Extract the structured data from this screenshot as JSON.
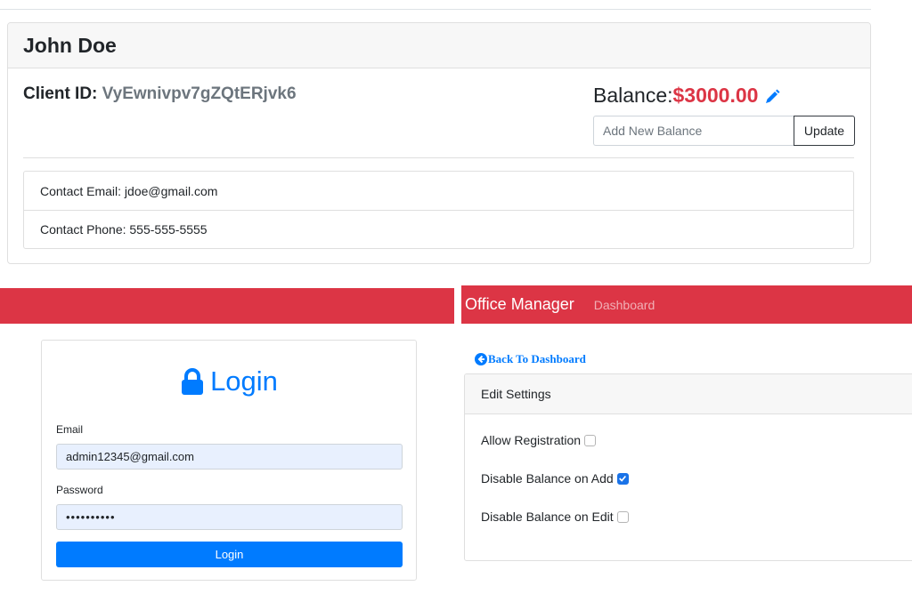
{
  "client": {
    "name": "John Doe",
    "id_label": "Client ID:",
    "id_value": "VyEwnivpv7gZQtERjvk6",
    "balance_label": "Balance:",
    "balance_value": "$3000.00",
    "balance_input_placeholder": "Add New Balance",
    "update_label": "Update",
    "contacts": [
      "Contact Email: jdoe@gmail.com",
      "Contact Phone: 555-555-5555"
    ]
  },
  "navbar": {
    "brand": "Office Manager",
    "link": "Dashboard"
  },
  "login": {
    "title": "Login",
    "email_label": "Email",
    "email_value": "admin12345@gmail.com",
    "password_label": "Password",
    "password_value": "••••••••••",
    "button_label": "Login"
  },
  "settings": {
    "back_label": "Back To Dashboard",
    "header": "Edit Settings",
    "items": [
      {
        "label": "Allow Registration",
        "checked": false
      },
      {
        "label": "Disable Balance on Add",
        "checked": true
      },
      {
        "label": "Disable Balance on Edit",
        "checked": false
      }
    ]
  },
  "colors": {
    "danger": "#dc3545",
    "primary": "#007bff",
    "navbar": "#dc3545"
  },
  "icons": {
    "balance_edit": "pencil-icon",
    "login_title": "lock-icon",
    "back": "arrow-left-circle-icon"
  }
}
